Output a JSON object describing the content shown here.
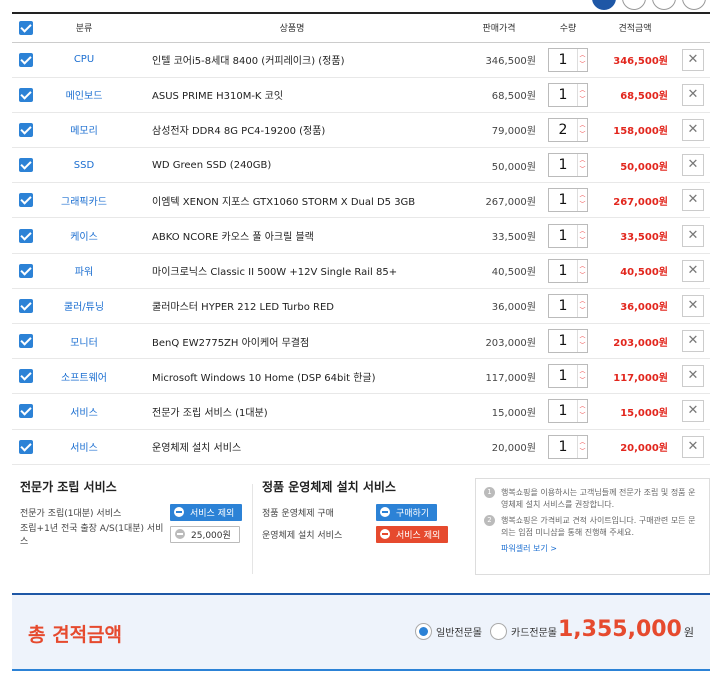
{
  "header": {
    "columns": [
      "분류",
      "상품명",
      "판매가격",
      "수량",
      "견적금액"
    ]
  },
  "items": [
    {
      "category": "CPU",
      "name": "인텔 코어i5-8세대 8400 (커피레이크) (정품)",
      "price": "346,500원",
      "qty": "1",
      "total": "346,500원"
    },
    {
      "category": "메인보드",
      "name": "ASUS PRIME H310M-K 코잇",
      "price": "68,500원",
      "qty": "1",
      "total": "68,500원"
    },
    {
      "category": "메모리",
      "name": "삼성전자 DDR4 8G PC4-19200 (정품)",
      "price": "79,000원",
      "qty": "2",
      "total": "158,000원"
    },
    {
      "category": "SSD",
      "name": "WD Green SSD (240GB)",
      "price": "50,000원",
      "qty": "1",
      "total": "50,000원"
    },
    {
      "category": "그래픽카드",
      "name": "이엠텍 XENON 지포스 GTX1060 STORM X Dual D5 3GB",
      "price": "267,000원",
      "qty": "1",
      "total": "267,000원"
    },
    {
      "category": "케이스",
      "name": "ABKO NCORE 카오스 풀 아크릴 블랙",
      "price": "33,500원",
      "qty": "1",
      "total": "33,500원"
    },
    {
      "category": "파워",
      "name": "마이크로닉스 Classic II 500W +12V Single Rail 85+",
      "price": "40,500원",
      "qty": "1",
      "total": "40,500원"
    },
    {
      "category": "쿨러/튜닝",
      "name": "쿨러마스터 HYPER 212 LED Turbo RED",
      "price": "36,000원",
      "qty": "1",
      "total": "36,000원"
    },
    {
      "category": "모니터",
      "name": "BenQ EW2775ZH 아이케어 무결점",
      "price": "203,000원",
      "qty": "1",
      "total": "203,000원"
    },
    {
      "category": "소프트웨어",
      "name": "Microsoft Windows 10 Home (DSP 64bit 한글)",
      "price": "117,000원",
      "qty": "1",
      "total": "117,000원"
    },
    {
      "category": "서비스",
      "name": "전문가 조립 서비스 (1대분)",
      "price": "15,000원",
      "qty": "1",
      "total": "15,000원"
    },
    {
      "category": "서비스",
      "name": "운영체제 설치 서비스",
      "price": "20,000원",
      "qty": "1",
      "total": "20,000원"
    }
  ],
  "assembly": {
    "title": "전문가 조립 서비스",
    "row1_label": "전문가 조립(1대분) 서비스",
    "row1_button": "서비스 제외",
    "row2_label": "조립+1년 전국 출장 A/S(1대분) 서비스",
    "row2_button": "25,000원"
  },
  "os_install": {
    "title": "정품 운영체제 설치 서비스",
    "row1_label": "정품 운영체제 구매",
    "row1_button": "구매하기",
    "row2_label": "운영체제 설치 서비스",
    "row2_button": "서비스 제외"
  },
  "notice": {
    "item1": "행복쇼핑을 이용하시는 고객님들께 전문가 조립 및 정품 운영체제 설치 서비스를 권장합니다.",
    "item2": "행복쇼핑은 가격비교 견적 사이트입니다. 구매관련 모든 문의는 입점 미니샵을 통해 진행해 주세요.",
    "link": "파워셀러 보기 >"
  },
  "total": {
    "label": "총 견적금액",
    "option1": "일반전문몰",
    "option2": "카드전문몰",
    "amount": "1,355,000",
    "unit": "원"
  },
  "colors": {
    "accent": "#2c82d6",
    "red": "#e64a2e",
    "navy": "#1e57a6"
  }
}
